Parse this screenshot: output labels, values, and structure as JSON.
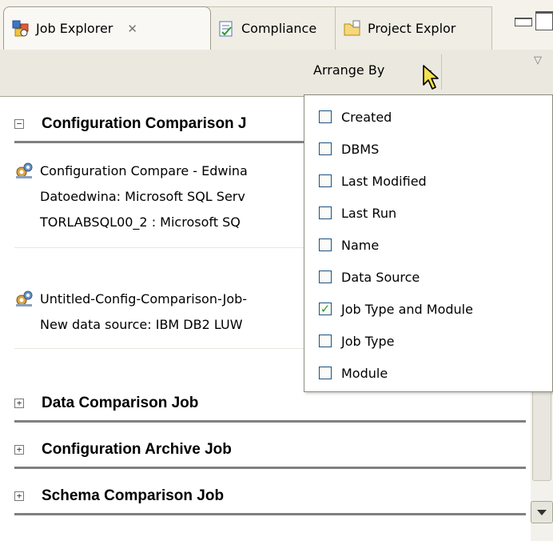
{
  "tabs": [
    {
      "label": "Job Explorer",
      "icon": "job-explorer-icon",
      "active": true,
      "close_glyph": "✕"
    },
    {
      "label": "Compliance",
      "icon": "compliance-icon",
      "active": false
    },
    {
      "label": "Project Explor",
      "icon": "project-explorer-icon",
      "active": false
    }
  ],
  "toolbar": {
    "arrange_label": "Arrange By"
  },
  "sections": [
    {
      "label": "Configuration Comparison J",
      "expander": "−",
      "expanded": true
    },
    {
      "label": "Data Comparison Job",
      "expander": "+",
      "expanded": false
    },
    {
      "label": "Configuration Archive Job",
      "expander": "+",
      "expanded": false
    },
    {
      "label": "Schema Comparison Job",
      "expander": "+",
      "expanded": false
    }
  ],
  "jobs": [
    {
      "title": "Configuration Compare - Edwina",
      "lines": [
        "Datoedwina: Microsoft SQL Serv",
        "TORLABSQL00_2 : Microsoft SQ"
      ]
    },
    {
      "title": "Untitled-Config-Comparison-Job-",
      "lines": [
        "New data source: IBM DB2 LUW"
      ]
    }
  ],
  "menu": {
    "items": [
      {
        "label": "Created",
        "checked": false
      },
      {
        "label": "DBMS",
        "checked": false
      },
      {
        "label": "Last Modified",
        "checked": false
      },
      {
        "label": "Last Run",
        "checked": false
      },
      {
        "label": "Name",
        "checked": false
      },
      {
        "label": "Data Source",
        "checked": false
      },
      {
        "label": "Job Type and Module",
        "checked": true
      },
      {
        "label": "Job Type",
        "checked": false
      },
      {
        "label": "Module",
        "checked": false
      }
    ]
  },
  "colors": {
    "tabbar_bg": "#f4f2ea",
    "toolbar_bg": "#ebe9df",
    "checkbox_border": "#1c5180",
    "check_mark": "#21a121",
    "cursor_fill": "#f4e04d"
  }
}
